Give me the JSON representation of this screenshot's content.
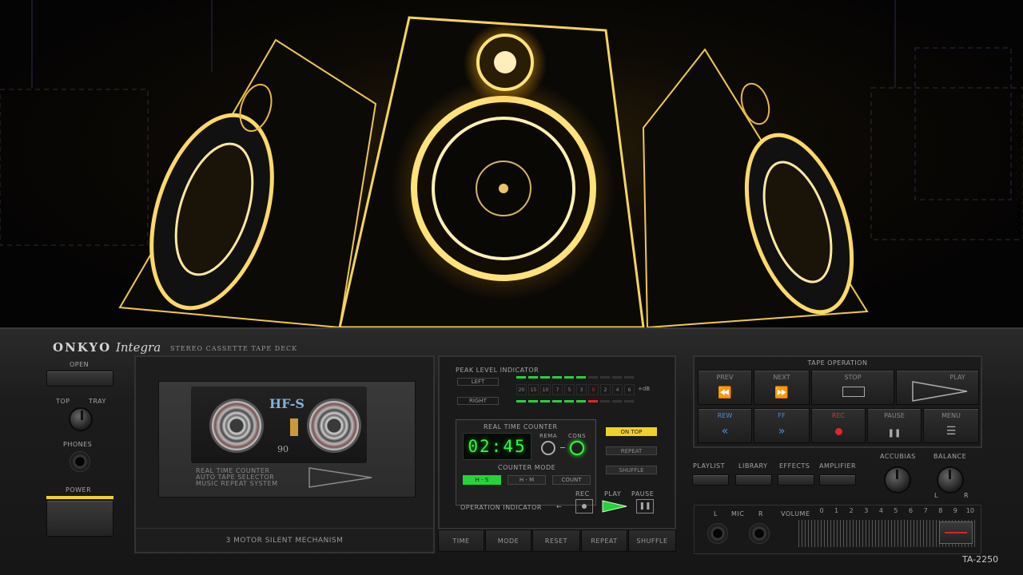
{
  "brand": {
    "maker": "ONKYO",
    "line": "Integra",
    "subtitle": "STEREO CASSETTE TAPE DECK",
    "model": "TA-2250"
  },
  "left": {
    "open": "OPEN",
    "top": "TOP",
    "tray": "TRAY",
    "phones": "PHONES",
    "power": "POWER"
  },
  "cassette": {
    "label": "HF-S",
    "length": "90",
    "features": [
      "REAL TIME COUNTER",
      "AUTO TAPE SELECTOR",
      "MUSIC REPEAT SYSTEM"
    ],
    "mechanism": "3 MOTOR  SILENT MECHANISM"
  },
  "peak": {
    "title": "PEAK LEVEL INDICATOR",
    "left": "LEFT",
    "right": "RIGHT",
    "scale": [
      "20",
      "15",
      "10",
      "7",
      "5",
      "3",
      "0",
      "2",
      "4",
      "6"
    ],
    "unit": "+dB"
  },
  "counter": {
    "title": "REAL TIME COUNTER",
    "time": "02:45",
    "rema": "REMA",
    "cons": "CONS",
    "mode_title": "COUNTER MODE",
    "modes": [
      "H - S",
      "H - M",
      "COUNT"
    ]
  },
  "side_buttons": [
    "ON TOP",
    "REPEAT",
    "SHUFFLE"
  ],
  "operation": {
    "title": "OPERATION INDICATOR",
    "arrow": "←",
    "rec": "REC",
    "play": "PLAY",
    "pause": "PAUSE"
  },
  "strip": [
    "TIME",
    "MODE",
    "RESET",
    "REPEAT",
    "SHUFFLE"
  ],
  "transport": {
    "title": "TAPE OPERATION",
    "prev": "PREV",
    "next": "NEXT",
    "stop": "STOP",
    "play": "PLAY",
    "rew": "REW",
    "ff": "FF",
    "rec": "REC",
    "pause": "PAUSE",
    "menu": "MENU",
    "icons": {
      "prev": "⏪",
      "next": "⏩",
      "rew": "«",
      "ff": "»",
      "pause": "❚❚",
      "menu": "☰"
    }
  },
  "utility": [
    "PLAYLIST",
    "LIBRARY",
    "EFFECTS",
    "AMPLIFIER"
  ],
  "knobs": {
    "accubias": "ACCUBIAS",
    "balance": "BALANCE",
    "bal_l": "L",
    "bal_r": "R"
  },
  "mic": {
    "l": "L",
    "mic": "MIC",
    "r": "R"
  },
  "volume": {
    "label": "VOLUME",
    "scale": [
      "0",
      "1",
      "2",
      "3",
      "4",
      "5",
      "6",
      "7",
      "8",
      "9",
      "10"
    ],
    "level": 10
  },
  "colors": {
    "accent_yellow": "#f2d02a",
    "lcd_green": "#2cff3a",
    "meter_green": "#27d23a",
    "meter_red": "#e0262a"
  }
}
